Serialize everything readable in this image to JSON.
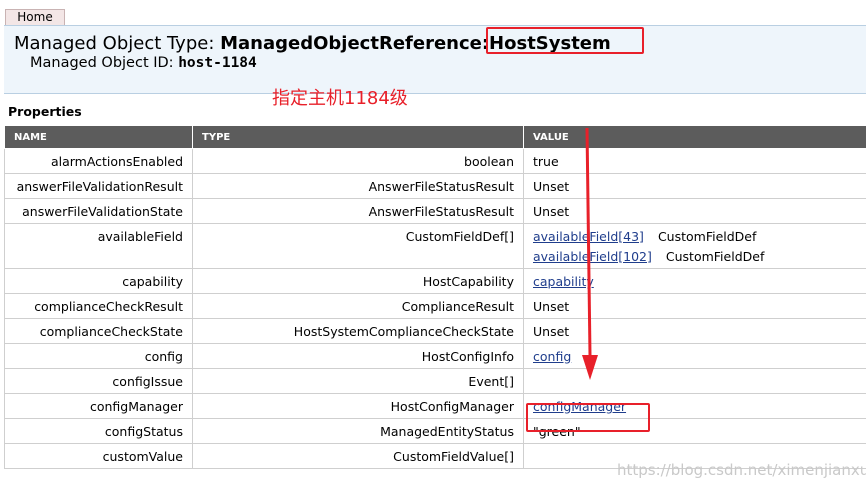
{
  "nav": {
    "home_label": "Home"
  },
  "header": {
    "type_label": "Managed Object Type: ",
    "type_value_prefix": "ManagedObjectReference:",
    "type_value_highlight": "HostSystem",
    "id_label": "Managed Object ID: ",
    "id_value": "host-1184"
  },
  "annotation": {
    "text": "指定主机1184级",
    "color": "#e8202a"
  },
  "properties": {
    "title": "Properties",
    "columns": [
      "NAME",
      "TYPE",
      "VALUE"
    ],
    "rows": [
      {
        "name": "alarmActionsEnabled",
        "type": "boolean",
        "values": [
          {
            "text": "true",
            "link": false
          }
        ]
      },
      {
        "name": "answerFileValidationResult",
        "type": "AnswerFileStatusResult",
        "values": [
          {
            "text": "Unset",
            "link": false
          }
        ]
      },
      {
        "name": "answerFileValidationState",
        "type": "AnswerFileStatusResult",
        "values": [
          {
            "text": "Unset",
            "link": false
          }
        ]
      },
      {
        "name": "availableField",
        "type": "CustomFieldDef[]",
        "values": [
          {
            "text": "availableField[43]",
            "link": true,
            "type_text": "CustomFieldDef"
          },
          {
            "text": "availableField[102]",
            "link": true,
            "type_text": "CustomFieldDef"
          }
        ]
      },
      {
        "name": "capability",
        "type": "HostCapability",
        "values": [
          {
            "text": "capability",
            "link": true
          }
        ]
      },
      {
        "name": "complianceCheckResult",
        "type": "ComplianceResult",
        "values": [
          {
            "text": "Unset",
            "link": false
          }
        ]
      },
      {
        "name": "complianceCheckState",
        "type": "HostSystemComplianceCheckState",
        "values": [
          {
            "text": "Unset",
            "link": false
          }
        ]
      },
      {
        "name": "config",
        "type": "HostConfigInfo",
        "values": [
          {
            "text": "config",
            "link": true
          }
        ]
      },
      {
        "name": "configIssue",
        "type": "Event[]",
        "values": []
      },
      {
        "name": "configManager",
        "type": "HostConfigManager",
        "values": [
          {
            "text": "configManager",
            "link": true
          }
        ]
      },
      {
        "name": "configStatus",
        "type": "ManagedEntityStatus",
        "values": [
          {
            "text": "\"green\"",
            "link": false
          }
        ]
      },
      {
        "name": "customValue",
        "type": "CustomFieldValue[]",
        "values": []
      }
    ]
  },
  "watermark": {
    "text": "https://blog.csdn.net/ximenjianxue"
  },
  "colors": {
    "highlight": "#e8202a",
    "header_bg": "#eef5fb",
    "table_header_bg": "#5c5c5c",
    "link": "#1f3d8c"
  }
}
